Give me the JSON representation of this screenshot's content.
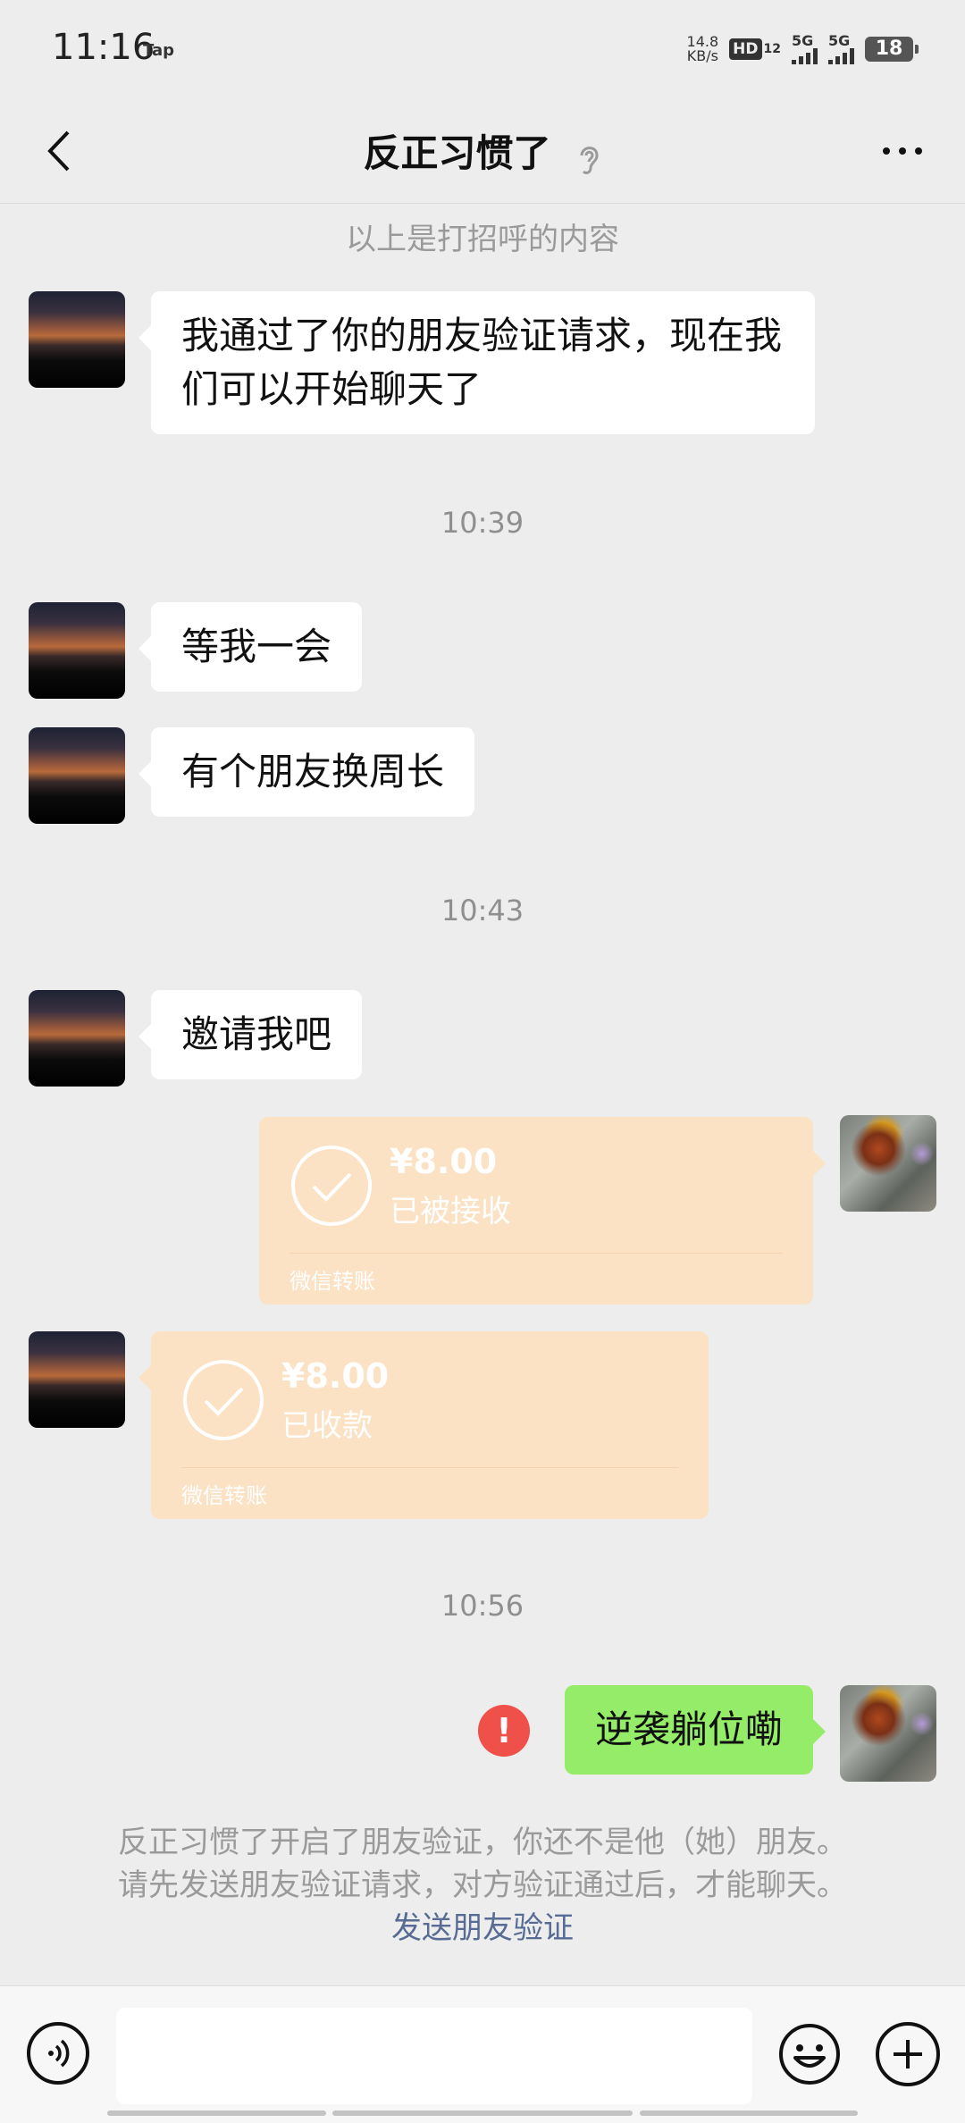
{
  "status_bar": {
    "time": "11:16",
    "app_tag": "Tap",
    "net_speed_value": "14.8",
    "net_speed_unit": "KB/s",
    "hd_label": "HD",
    "hd_sim": "12",
    "signal1_label": "5G",
    "signal2_label": "5G",
    "battery": "18"
  },
  "header": {
    "title": "反正习惯了",
    "back_icon": "chevron-left-icon",
    "mode_icon": "ear-icon",
    "more_icon": "more-dots-icon"
  },
  "chat": {
    "greeting_note": "以上是打招呼的内容",
    "messages": [
      {
        "side": "left",
        "type": "text",
        "text": "我通过了你的朋友验证请求，现在我们可以开始聊天了"
      },
      {
        "type": "time",
        "text": "10:39"
      },
      {
        "side": "left",
        "type": "text",
        "text": "等我一会"
      },
      {
        "side": "left",
        "type": "text",
        "text": "有个朋友换周长"
      },
      {
        "type": "time",
        "text": "10:43"
      },
      {
        "side": "left",
        "type": "text",
        "text": "邀请我吧"
      },
      {
        "side": "right",
        "type": "transfer",
        "amount": "¥8.00",
        "status": "已被接收",
        "brand": "微信转账"
      },
      {
        "side": "left",
        "type": "transfer",
        "amount": "¥8.00",
        "status": "已收款",
        "brand": "微信转账"
      },
      {
        "type": "time",
        "text": "10:56"
      },
      {
        "side": "right",
        "type": "text",
        "text": "逆袭躺位嘞",
        "send_failed": true
      }
    ],
    "system_note": {
      "line1": "反正习惯了开启了朋友验证，你还不是他（她）朋友。",
      "line2": "请先发送朋友验证请求，对方验证通过后，才能聊天。",
      "link": "发送朋友验证"
    }
  },
  "input_bar": {
    "text_value": "",
    "voice_icon": "voice-icon",
    "emoji_icon": "emoji-icon",
    "plus_icon": "plus-icon"
  },
  "colors": {
    "background": "#ededed",
    "self_bubble": "#95ec69",
    "other_bubble": "#ffffff",
    "transfer_bubble": "#fce2c4",
    "error": "#f0504a",
    "link": "#576b95"
  }
}
